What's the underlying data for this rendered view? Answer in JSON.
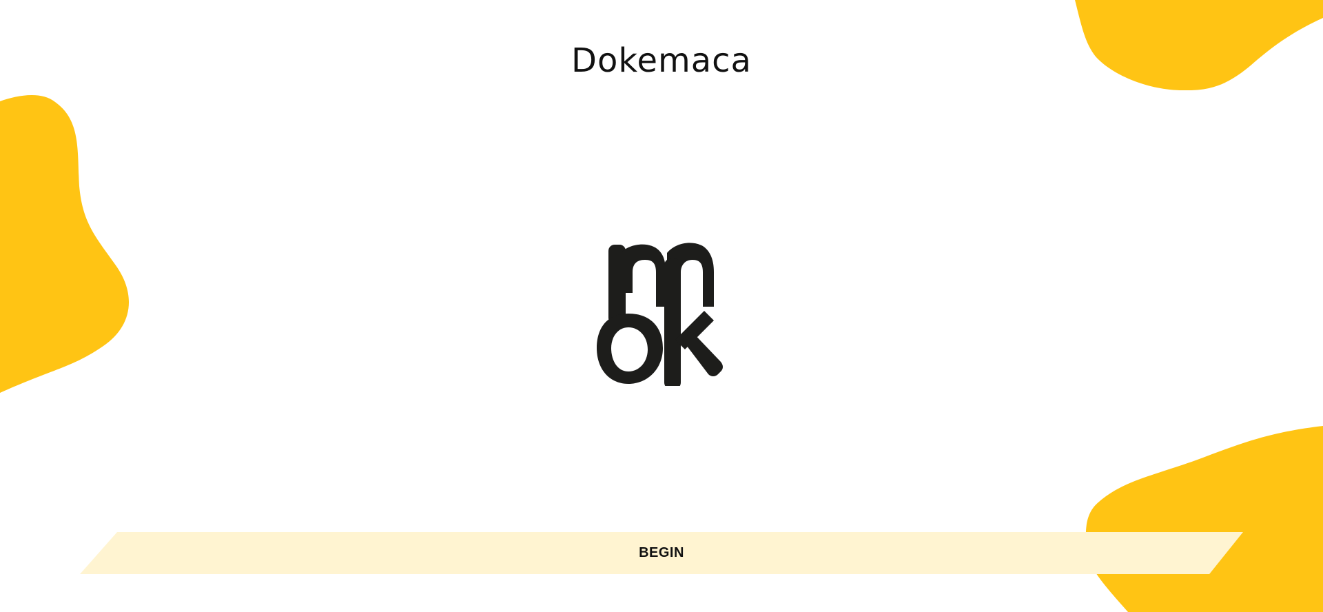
{
  "app": {
    "title": "Dokemaca"
  },
  "logo": {
    "icon": "dokemaca-monogram-logo",
    "color": "#1d1d1b"
  },
  "actions": {
    "begin_label": "BEGIN",
    "begin_bg": "#fff4d1"
  },
  "decor": {
    "blob_color": "#ffc414"
  }
}
